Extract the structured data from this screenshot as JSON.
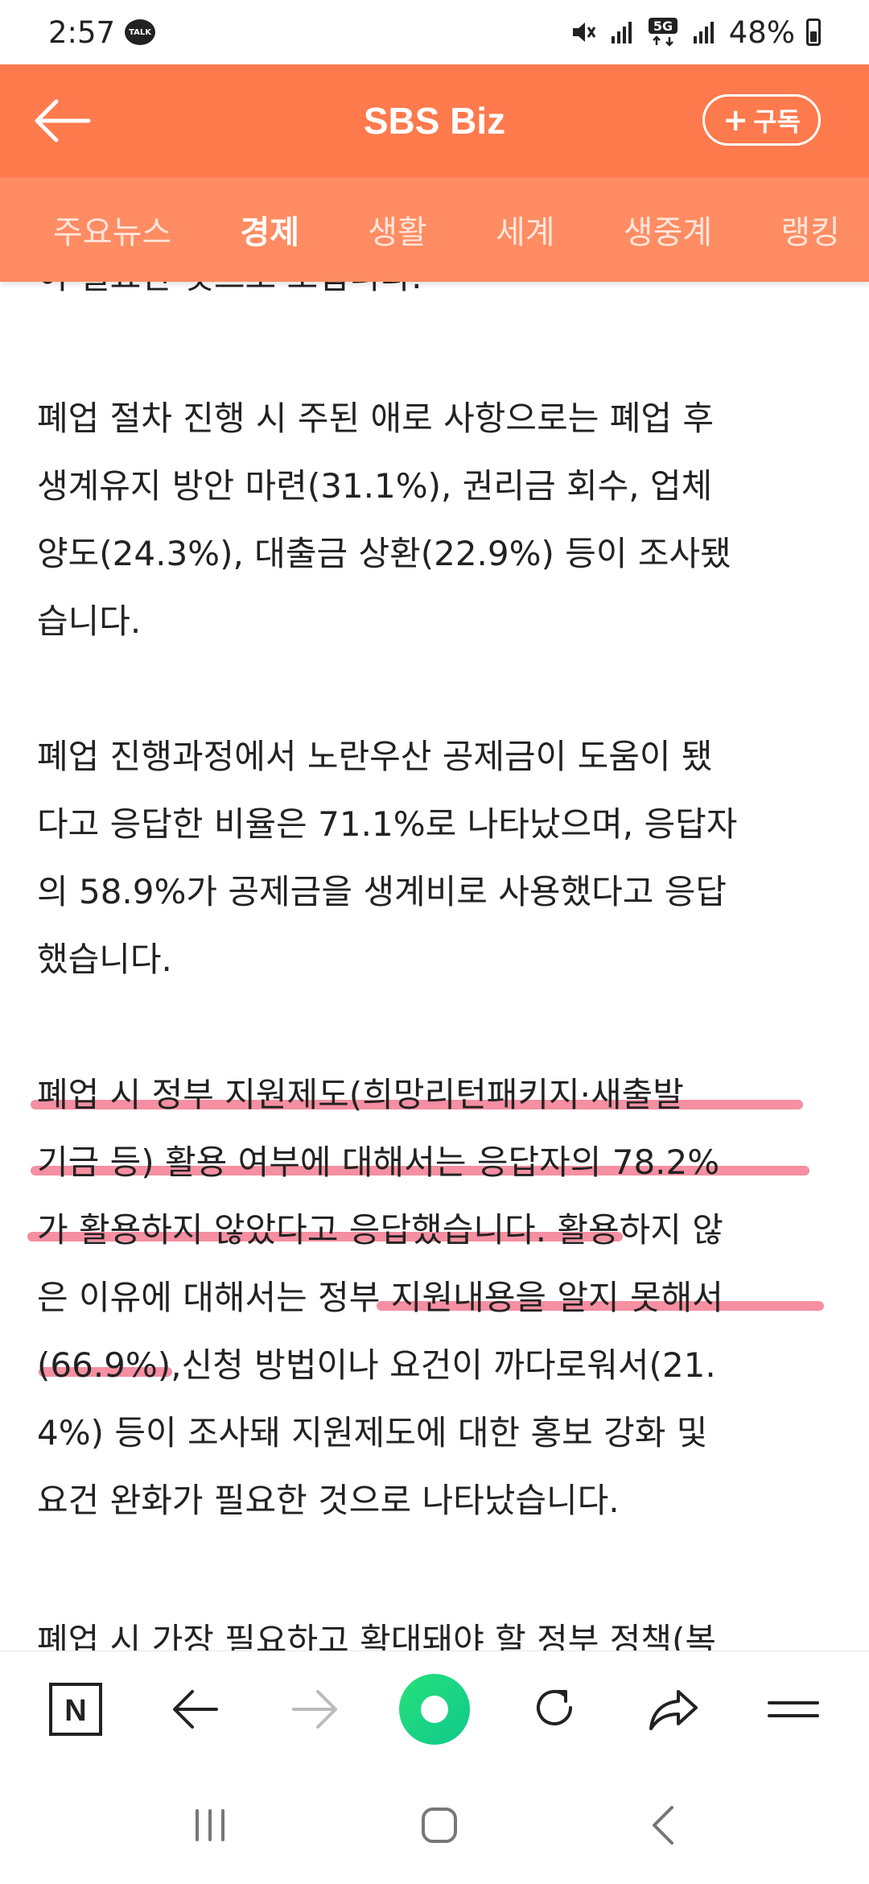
{
  "status_bar": {
    "time": "2:57",
    "talk_badge": "TALK",
    "network_badge": "5G",
    "battery": "48%"
  },
  "header": {
    "title": "SBS Biz",
    "subscribe_label": "구독"
  },
  "tabs": [
    {
      "label": "주요뉴스",
      "active": false
    },
    {
      "label": "경제",
      "active": true
    },
    {
      "label": "생활",
      "active": false
    },
    {
      "label": "세계",
      "active": false
    },
    {
      "label": "생중계",
      "active": false
    },
    {
      "label": "랭킹",
      "active": false
    }
  ],
  "article": {
    "cut_top": "이 필요한 것으로 보입니다.",
    "p1": [
      "폐업 절차 진행 시 주된 애로 사항으로는 폐업 후",
      "생계유지 방안 마련(31.1%), 권리금 회수, 업체",
      "양도(24.3%), 대출금 상환(22.9%) 등이 조사됐",
      "습니다."
    ],
    "p2": [
      "폐업 진행과정에서 노란우산 공제금이 도움이 됐",
      "다고 응답한 비율은 71.1%로 나타났으며, 응답자",
      "의 58.9%가 공제금을 생계비로 사용했다고 응답",
      "했습니다."
    ],
    "p3": [
      "폐업 시 정부 지원제도(희망리턴패키지·새출발",
      "기금 등) 활용 여부에 대해서는 응답자의 78.2%",
      "가 활용하지 않았다고 응답했습니다. 활용하지 않",
      "은 이유에 대해서는 정부 지원내용을 알지 못해서",
      "(66.9%),신청 방법이나 요건이 까다로워서(21.",
      "4%) 등이 조사돼 지원제도에 대한 홍보 강화 및",
      "요건 완화가 필요한 것으로 나타났습니다."
    ],
    "cut_bottom": "폐업 시 가장 필요하고 확대돼야 할 정부 정책(복"
  },
  "browser_nav": {
    "naver_letter": "N"
  },
  "colors": {
    "header": "#FF7A4D",
    "tabs": "#FF8C62",
    "highlight": "#F2738A",
    "green": "#1FD27F"
  }
}
